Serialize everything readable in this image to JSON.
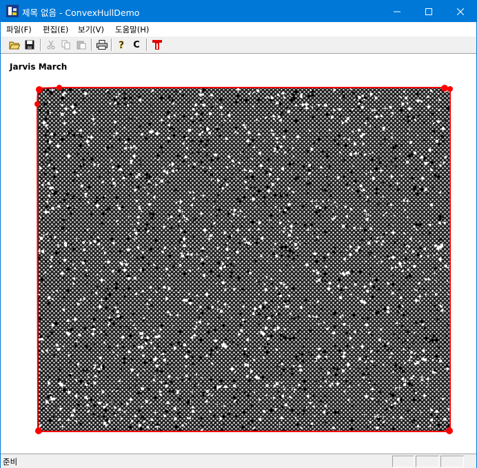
{
  "window": {
    "title": "제목 없음 - ConvexHullDemo",
    "minimize_icon": "minimize-icon",
    "maximize_icon": "maximize-icon",
    "close_icon": "close-icon"
  },
  "menu": {
    "items": [
      "파일(F)",
      "편집(E)",
      "보기(V)",
      "도움말(H)"
    ]
  },
  "toolbar": {
    "buttons": [
      {
        "icon": "open-folder-icon",
        "enabled": true
      },
      {
        "icon": "save-icon",
        "enabled": true
      },
      {
        "icon": "cut-icon",
        "enabled": false
      },
      {
        "icon": "copy-icon",
        "enabled": false
      },
      {
        "icon": "paste-icon",
        "enabled": false
      },
      {
        "icon": "print-icon",
        "enabled": true
      },
      {
        "icon": "help-icon",
        "enabled": true
      },
      {
        "icon": "clear-icon",
        "label": "C",
        "enabled": true
      },
      {
        "icon": "hull-icon",
        "enabled": true
      }
    ]
  },
  "canvas": {
    "algorithm_label": "Jarvis March",
    "hull_color": "#ff0000",
    "point_color": "#000000"
  },
  "statusbar": {
    "text": "준비"
  }
}
